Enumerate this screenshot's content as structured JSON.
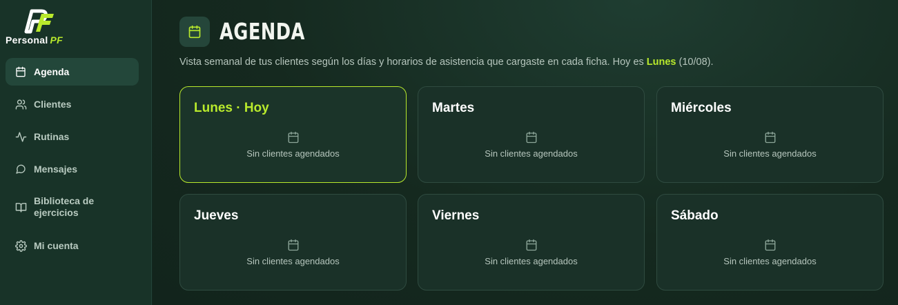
{
  "brand": {
    "name": "Personal",
    "suffix": "PF",
    "accent": "#b9ea2c"
  },
  "sidebar": {
    "items": [
      {
        "label": "Agenda",
        "icon": "calendar-icon",
        "active": true
      },
      {
        "label": "Clientes",
        "icon": "users-icon",
        "active": false
      },
      {
        "label": "Rutinas",
        "icon": "activity-icon",
        "active": false
      },
      {
        "label": "Mensajes",
        "icon": "message-icon",
        "active": false
      },
      {
        "label": "Biblioteca de ejercicios",
        "icon": "book-icon",
        "active": false
      },
      {
        "label": "Mi cuenta",
        "icon": "gear-icon",
        "active": false
      }
    ]
  },
  "header": {
    "title": "AGENDA",
    "subtitle_before": "Vista semanal de tus clientes según los días y horarios de asistencia que cargaste en cada ficha. Hoy es ",
    "subtitle_day": "Lunes",
    "subtitle_after": " (10/08)."
  },
  "days": [
    {
      "name": "Lunes · Hoy",
      "today": true,
      "empty_text": "Sin clientes agendados"
    },
    {
      "name": "Martes",
      "today": false,
      "empty_text": "Sin clientes agendados"
    },
    {
      "name": "Miércoles",
      "today": false,
      "empty_text": "Sin clientes agendados"
    },
    {
      "name": "Jueves",
      "today": false,
      "empty_text": "Sin clientes agendados"
    },
    {
      "name": "Viernes",
      "today": false,
      "empty_text": "Sin clientes agendados"
    },
    {
      "name": "Sábado",
      "today": false,
      "empty_text": "Sin clientes agendados"
    }
  ]
}
